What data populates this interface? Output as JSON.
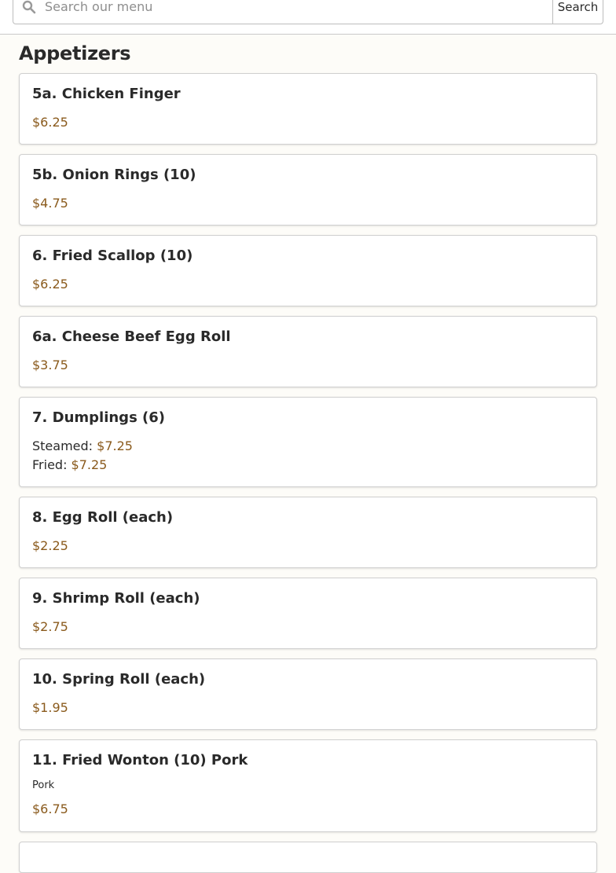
{
  "search": {
    "placeholder": "Search our menu",
    "value": "",
    "button_label": "Search"
  },
  "section": {
    "title": "Appetizers"
  },
  "items": [
    {
      "name": "5a. Chicken Finger",
      "price": "$6.25"
    },
    {
      "name": "5b. Onion Rings (10)",
      "price": "$4.75"
    },
    {
      "name": "6. Fried Scallop (10)",
      "price": "$6.25"
    },
    {
      "name": "6a. Cheese Beef Egg Roll",
      "price": "$3.75"
    },
    {
      "name": "7. Dumplings (6)",
      "options": [
        {
          "label": "Steamed:",
          "price": "$7.25"
        },
        {
          "label": "Fried:",
          "price": "$7.25"
        }
      ]
    },
    {
      "name": "8. Egg Roll (each)",
      "price": "$2.25"
    },
    {
      "name": "9. Shrimp Roll (each)",
      "price": "$2.75"
    },
    {
      "name": "10. Spring Roll (each)",
      "price": "$1.95"
    },
    {
      "name": "11. Fried Wonton (10) Pork",
      "description": "Pork",
      "price": "$6.75"
    }
  ],
  "colors": {
    "price": "#8a5a1c",
    "background": "#fdfcf8",
    "card_border": "#cfcfcf"
  },
  "icons": {
    "search": "search-icon"
  }
}
